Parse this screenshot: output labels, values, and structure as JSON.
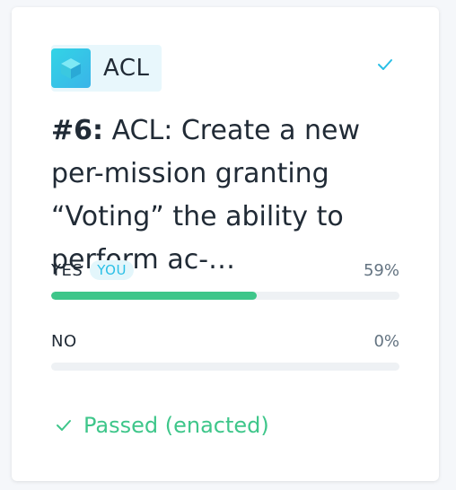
{
  "app": {
    "name": "ACL",
    "icon": "cube-icon",
    "accent": "#32d4e6"
  },
  "vote": {
    "number": "#6:",
    "title": "ACL: Create a new per-mission granting “Voting” the ability to perform ac-…",
    "options": [
      {
        "label": "YES",
        "badge": "YOU",
        "percent": "59%",
        "fraction": 0.59,
        "color": "#3ec68a"
      },
      {
        "label": "NO",
        "badge": "",
        "percent": "0%",
        "fraction": 0.0,
        "color": "#3ec68a"
      }
    ],
    "status": "Passed (enacted)",
    "status_color": "#3ec68a"
  }
}
